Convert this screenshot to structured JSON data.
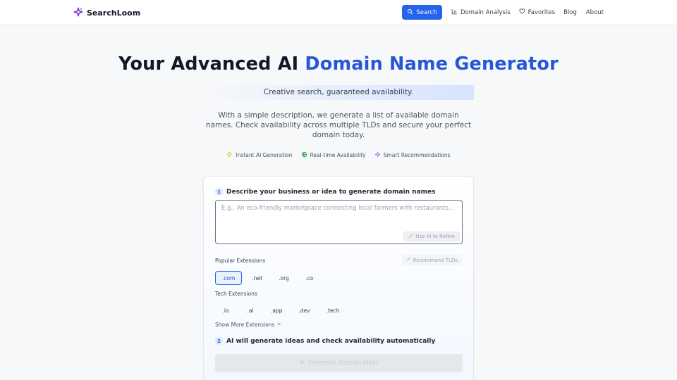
{
  "header": {
    "brand": "SearchLoom",
    "search_label": "Search",
    "nav": {
      "domain_analysis": "Domain Analysis",
      "favorites": "Favorites",
      "blog": "Blog",
      "about": "About"
    }
  },
  "hero": {
    "title_plain": "Your Advanced AI",
    "title_accent": "Domain Name Generator",
    "tagline": "Creative search, guaranteed availability.",
    "description": "With a simple description, we generate a list of available domain names. Check availability across multiple TLDs and secure your perfect domain today.",
    "features": [
      {
        "label": "Instant AI Generation",
        "icon": "lightning-icon"
      },
      {
        "label": "Real-time Availability",
        "icon": "globe-icon"
      },
      {
        "label": "Smart Recommendations",
        "icon": "sparkle-icon"
      }
    ]
  },
  "form": {
    "step1": {
      "number": "1",
      "label": "Describe your business or idea to generate domain names"
    },
    "input_placeholder": "E.g., An eco-friendly marketplace connecting local farmers with restaurants...",
    "refine_label": "Use AI to Refine",
    "popular_label": "Popular Extensions",
    "recommend_label": "Recommend TLDs",
    "popular_extensions": [
      ".com",
      ".net",
      ".org",
      ".co"
    ],
    "selected_extension": ".com",
    "tech_label": "Tech Extensions",
    "tech_extensions": [
      ".io",
      ".ai",
      ".app",
      ".dev",
      ".tech"
    ],
    "show_more_label": "Show More Extensions",
    "step2": {
      "number": "2",
      "label": "AI will generate ideas and check availability automatically"
    },
    "generate_label": "Generate Domain Ideas"
  },
  "colors": {
    "accent": "#2563eb",
    "title_accent": "#2557d6"
  }
}
